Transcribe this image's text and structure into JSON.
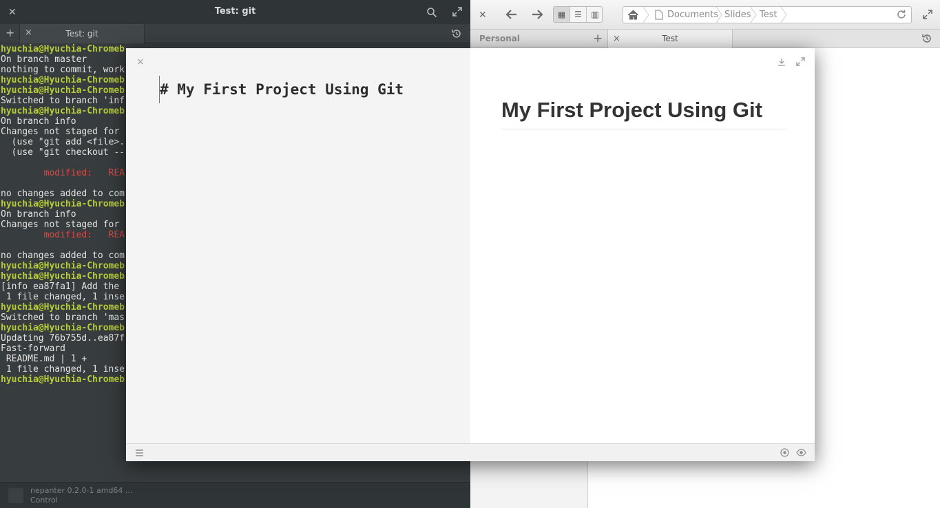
{
  "terminal": {
    "title": "Test: git",
    "tab_label": "Test: git",
    "new_tab_symbol": "+",
    "close_symbol": "×",
    "lines": [
      {
        "text": "hyuchia@Hyuchia-Chromeb",
        "style": "green"
      },
      {
        "text": "On branch master",
        "style": "plain"
      },
      {
        "text": "nothing to commit, work",
        "style": "plain"
      },
      {
        "text": "hyuchia@Hyuchia-Chromeb",
        "style": "green"
      },
      {
        "text": "hyuchia@Hyuchia-Chromeb",
        "style": "green"
      },
      {
        "text": "Switched to branch 'inf",
        "style": "plain"
      },
      {
        "text": "hyuchia@Hyuchia-Chromeb",
        "style": "green"
      },
      {
        "text": "On branch info",
        "style": "plain"
      },
      {
        "text": "Changes not staged for",
        "style": "plain"
      },
      {
        "text": "  (use \"git add <file>.",
        "style": "plain"
      },
      {
        "text": "  (use \"git checkout --",
        "style": "plain"
      },
      {
        "text": "",
        "style": "plain"
      },
      {
        "text": "        modified:   REA",
        "style": "red"
      },
      {
        "text": "",
        "style": "plain"
      },
      {
        "text": "no changes added to com",
        "style": "plain"
      },
      {
        "text": "hyuchia@Hyuchia-Chromeb",
        "style": "green"
      },
      {
        "text": "On branch info",
        "style": "plain"
      },
      {
        "text": "Changes not staged for",
        "style": "plain"
      },
      {
        "text": "        modified:   REA",
        "style": "red"
      },
      {
        "text": "",
        "style": "plain"
      },
      {
        "text": "no changes added to com",
        "style": "plain"
      },
      {
        "text": "hyuchia@Hyuchia-Chromeb",
        "style": "green"
      },
      {
        "text": "hyuchia@Hyuchia-Chromeb",
        "style": "green"
      },
      {
        "text": "[info ea87fa1] Add the",
        "style": "plain"
      },
      {
        "text": " 1 file changed, 1 inse",
        "style": "plain"
      },
      {
        "text": "hyuchia@Hyuchia-Chromeb",
        "style": "green"
      },
      {
        "text": "Switched to branch 'mas",
        "style": "plain"
      },
      {
        "text": "hyuchia@Hyuchia-Chromeb",
        "style": "green"
      },
      {
        "text": "Updating 76b755d..ea87f",
        "style": "plain"
      },
      {
        "text": "Fast-forward",
        "style": "plain"
      },
      {
        "text": " README.md | 1 +",
        "style": "plain"
      },
      {
        "text": " 1 file changed, 1 inse",
        "style": "plain"
      },
      {
        "text": "hyuchia@Hyuchia-Chromeb",
        "style": "green"
      }
    ],
    "status_line1": "nepanter 0.2.0-1 amd64 ...",
    "status_line2": "Control"
  },
  "files": {
    "breadcrumbs": [
      "Documents",
      "Slides",
      "Test"
    ],
    "sidebar_heading": "Personal",
    "tab_label": "Test",
    "new_tab_symbol": "+",
    "close_symbol": "×"
  },
  "editor": {
    "close_symbol": "×",
    "markdown_source": "# My First Project Using Git",
    "preview_heading": "My First Project Using Git"
  },
  "icons": {
    "terminal": [
      "close-icon",
      "search-icon",
      "maximize-icon",
      "new-tab-icon",
      "history-icon"
    ],
    "files": [
      "back-arrow-icon",
      "forward-arrow-icon",
      "grid-view-icon",
      "list-view-icon",
      "column-view-icon",
      "home-icon",
      "folder-icon",
      "reload-icon",
      "maximize-icon",
      "history-icon"
    ],
    "editor": [
      "close-icon",
      "download-icon",
      "fullscreen-icon",
      "menu-icon",
      "target-icon",
      "eye-icon"
    ]
  },
  "colors": {
    "prompt_green": "#b6cc3b",
    "modified_red": "#e24545",
    "terminal_bg": "#373c3e",
    "editor_source_bg": "#f4f4f4"
  }
}
